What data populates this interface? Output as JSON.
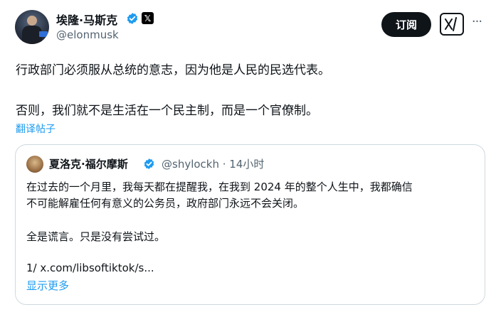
{
  "author": {
    "name": "埃隆·马斯克",
    "handle": "@elonmusk",
    "x_badge": "𝕏"
  },
  "actions": {
    "subscribe_label": "订阅",
    "grok_icon": "grok-icon",
    "more_label": "···"
  },
  "post": {
    "paragraphs": [
      "行政部门必须服从总统的意志，因为他是人民的民选代表。",
      "否则，我们就不是生活在一个民主制，而是一个官僚制。"
    ],
    "translate_label": "翻译帖子"
  },
  "quoted": {
    "name": "夏洛克·福尔摩斯",
    "handle_time": "@shylockh · 14小时",
    "lines": [
      "在过去的一个月里，我每天都在提醒我，在我到 2024 年的整个人生中，我都确信",
      "不可能解雇任何有意义的公务员，政府部门永远不会关闭。",
      "全是谎言。只是没有尝试过。",
      "1/ x.com/libsoftiktok/s..."
    ],
    "show_more_label": "显示更多"
  },
  "colors": {
    "accent": "#1d9bf0",
    "text": "#0f1419",
    "muted": "#536471",
    "border": "#cfd9de"
  }
}
